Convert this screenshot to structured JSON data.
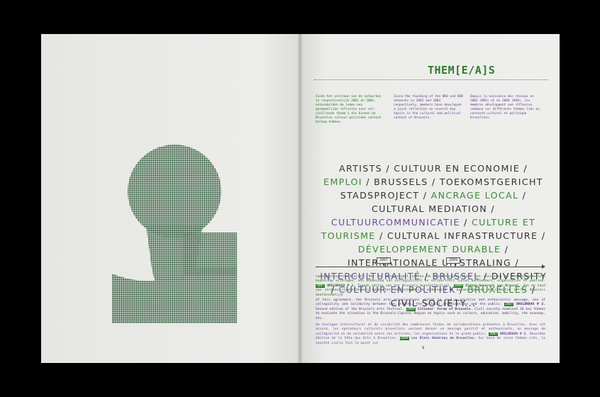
{
  "right_page": {
    "title": "THEM[E/A]S",
    "intro_nl": "Sinds het ontstaan van de netwerken in respectievelijk 2002 en 2004, ontwikkelden de leden een gezamenlijke reflectie over ver-schillende thema's die binnen de Brusselse cultuur-politieke context belang hebben.",
    "intro_en": "Since the founding of the BKO and RAB networks in 2002 and 2004 respectively, members have developed a joint reflection on several key topics in the cultural and political context of Brussels.",
    "intro_fr": "Depuis la naissance des réseaux en 2002 (BKO) et en 2004 (RAB), les membres développent une réflexion commune sur différents thèmes liés au contexte culturel et politique bruxellois.",
    "themes": [
      {
        "text": "ARTISTS",
        "tone": "dark"
      },
      {
        "text": "CULTUUR EN ECONOMIE",
        "tone": "dark"
      },
      {
        "text": "EMPLOI",
        "tone": "green"
      },
      {
        "text": "BRUSSELS",
        "tone": "dark"
      },
      {
        "text": "TOEKOMSTGERICHT STADSPROJECT",
        "tone": "dark"
      },
      {
        "text": "ANCRAGE LOCAL",
        "tone": "green"
      },
      {
        "text": "CULTURAL MEDIATION",
        "tone": "dark"
      },
      {
        "text": "CULTUURCOMMUNICATIE",
        "tone": "purple"
      },
      {
        "text": "CULTURE ET TOURISME",
        "tone": "green"
      },
      {
        "text": "CULTURAL INFRASTRUCTURE",
        "tone": "dark"
      },
      {
        "text": "DÉVELOPPEMENT DURABLE",
        "tone": "green"
      },
      {
        "text": "INTERNATIONALE UITSTRALING",
        "tone": "dark"
      },
      {
        "text": "INTERCULTURALITÉ",
        "tone": "purple"
      },
      {
        "text": "BRUSSEL",
        "tone": "purple"
      },
      {
        "text": "DIVERSITY",
        "tone": "dark"
      },
      {
        "text": "CULTUUR EN POLITIEK",
        "tone": "purple"
      },
      {
        "text": "BRUXELLES",
        "tone": "green"
      },
      {
        "text": "CIVIL SOCIETY...",
        "tone": "dark"
      }
    ],
    "timeline": {
      "year_1": "2007",
      "year_2": "2009"
    },
    "para_nl": {
      "a": "samenwerking in Brussel. Met de overeenkomst willen de kunstenorganisaties een positieve en enthousiasmerende boodschap uitdragen, een boodschap van collegialiteit en solidariteit tussen kunstenaars, organisaties en publiek.",
      "y1": "2007",
      "b": "BRXLBRAVO # 2.",
      "c": "Tweede editie van het Brussels kunstenfestival.",
      "y2": "2009",
      "d": "Staten-Generaal van Brussel.",
      "e": "Aan de hand van zestien sleutelthema's maakt het maatschappelijk middenveld de balans op van de situatie in het Brussels Hoofdstedelijk"
    },
    "para_en": {
      "a": "of this agreement, the Brussels arts organisations wanted to send a positive and enthusiastic message, one of collegiality and solidarity between the artists, the cultural organisations and the public.",
      "y1": "2007",
      "b": "BRXLBRAVO # 2.",
      "c": "Second edition of the Brussels arts festival.",
      "y2": "2009",
      "d": "Citizens' Forum of Brussels.",
      "e": "Civil society examined 16 key themes to evaluate the situation in the Brussels-Capital Region on topics such as culture, education, mobility, the economy, etc."
    },
    "para_fr": {
      "a": "de dialogue interculturel et de visibilité des nombreuses formes de collaborations présentes à Bruxelles. Avec cet accord, les opérateurs culturels bruxellois veulent donner un message positif et enthousiaste, un message de collégialité et de solidarité entre les artistes, les organisations et le grand public.",
      "y1": "2007",
      "b": "BRXLBRAVO # 2.",
      "c": "Deuxième édition de la Fête des Arts à Bruxelles.",
      "y2": "2009",
      "d": "Les États Généraux de Bruxelles.",
      "e": "Sur base de seize thèmes-clés, la société civile fait le point sur"
    },
    "page_number": "9"
  },
  "colors": {
    "dot_fill": "#2f5a3c",
    "accent_green": "#2f7a2c",
    "accent_purple": "#6a4a9a"
  }
}
